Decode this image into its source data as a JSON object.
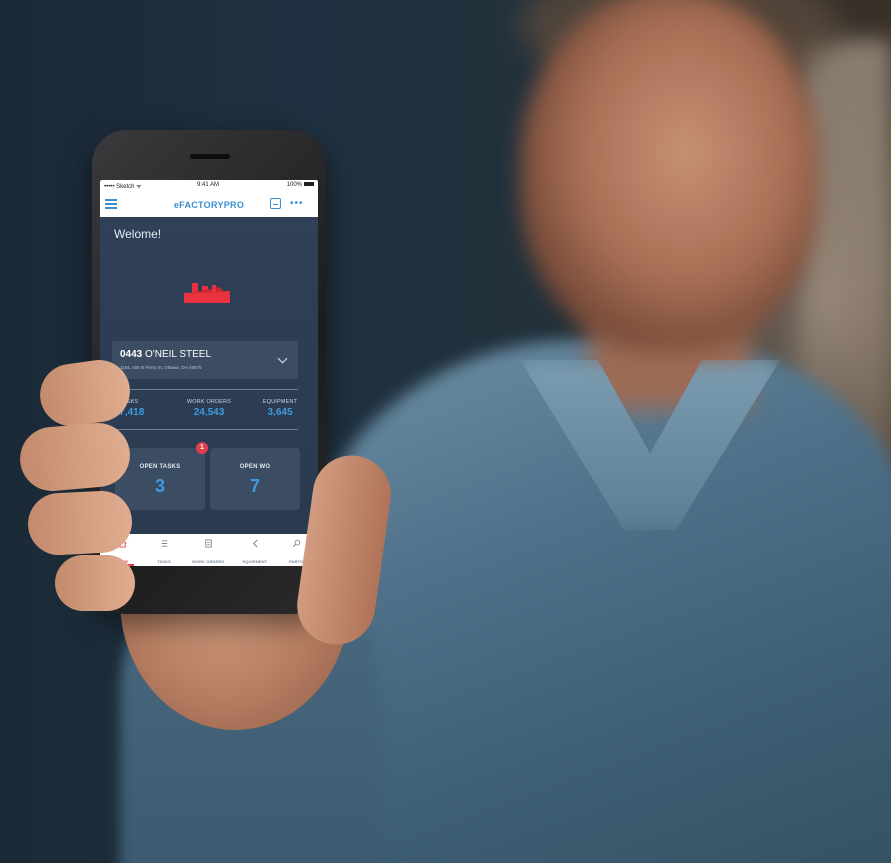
{
  "status_bar": {
    "carrier": "••••• Sketch ᯤ",
    "time": "9:41 AM",
    "battery": "100%"
  },
  "app_bar": {
    "title": "eFACTORYPRO",
    "more": "•••"
  },
  "welcome_text": "Welome!",
  "site": {
    "code": "0443",
    "name": "O'NEIL STEEL",
    "address": "1104, 485 N Perry St, Ottawa, OH 45875"
  },
  "stats": [
    {
      "label": "TASKS",
      "value": "17,418"
    },
    {
      "label": "WORK ORDERS",
      "value": "24,543"
    },
    {
      "label": "EQUIPMENT",
      "value": "3,645"
    }
  ],
  "tiles": [
    {
      "label": "OPEN TASKS",
      "value": "3",
      "badge": "1"
    },
    {
      "label": "OPEN WO",
      "value": "7"
    }
  ],
  "tabs": [
    {
      "label": "HOME",
      "icon": "home-icon",
      "active": true
    },
    {
      "label": "TASKS",
      "icon": "list-icon"
    },
    {
      "label": "WORK ORDERS",
      "icon": "document-icon"
    },
    {
      "label": "EQUIPMENT",
      "icon": "wrench-icon"
    },
    {
      "label": "PARTS",
      "icon": "search-icon"
    }
  ],
  "colors": {
    "accent_blue": "#3a8fd0",
    "value_blue": "#3f9be0",
    "alert_red": "#e23d4a",
    "screen_bg": "#2f4057"
  }
}
